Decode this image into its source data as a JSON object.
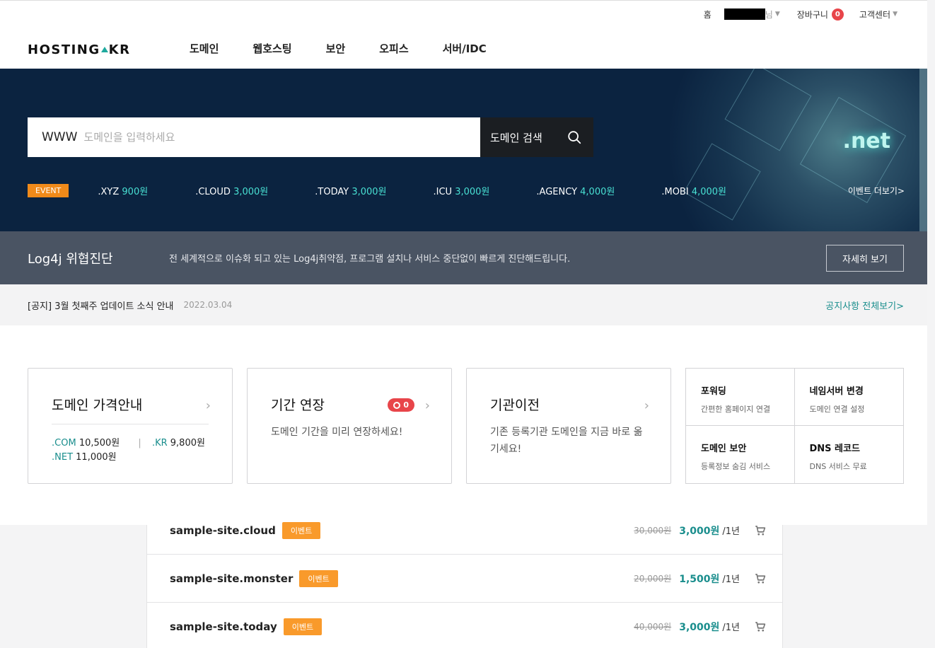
{
  "util": {
    "home": "홈",
    "user_suffix": "님",
    "cart_label": "장바구니",
    "cart_count": "0",
    "support": "고객센터"
  },
  "brand": {
    "logo_left": "HOSTING",
    "logo_right": "KR"
  },
  "gnb": [
    "도메인",
    "웹호스팅",
    "보안",
    "오피스",
    "서버/IDC"
  ],
  "hero": {
    "prefix": "WWW",
    "placeholder": "도메인을 입력하세요",
    "search_button": "도메인 검색",
    "tld_art": ".net",
    "event_tag": "EVENT",
    "events": [
      {
        "tld": ".XYZ",
        "price": "900원"
      },
      {
        "tld": ".CLOUD",
        "price": "3,000원"
      },
      {
        "tld": ".TODAY",
        "price": "3,000원"
      },
      {
        "tld": ".ICU",
        "price": "3,000원"
      },
      {
        "tld": ".AGENCY",
        "price": "4,000원"
      },
      {
        "tld": ".MOBI",
        "price": "4,000원"
      }
    ],
    "events_more": "이벤트 더보기>"
  },
  "log4j": {
    "title": "Log4j 위협진단",
    "desc": "전 세계적으로 이슈화 되고 있는 Log4j취약점, 프로그램 설치나 서비스 중단없이 빠르게 진단해드립니다.",
    "button": "자세히 보기"
  },
  "notice": {
    "text": "[공지] 3월 첫째주 업데이트 소식 안내",
    "date": "2022.03.04",
    "all": "공지사항 전체보기>"
  },
  "cards": {
    "price": {
      "title": "도메인 가격안내",
      "com_ext": ".COM",
      "com_price": "10,500원",
      "sep": "|",
      "kr_ext": ".KR",
      "kr_price": "9,800원",
      "net_ext": ".NET",
      "net_price": "11,000원"
    },
    "renew": {
      "title": "기간 연장",
      "count": "0",
      "desc": "도메인 기간을 미리 연장하세요!"
    },
    "transfer": {
      "title": "기관이전",
      "desc": "기존 등록기관 도메인을 지금 바로 옮기세요!"
    },
    "quick": [
      {
        "title": "포워딩",
        "sub": "간편한 홈페이지 연결"
      },
      {
        "title": "네임서버 변경",
        "sub": "도메인 연결 설정"
      },
      {
        "title": "도메인 보안",
        "sub": "등록정보 숨김 서비스"
      },
      {
        "title": "DNS 레코드",
        "sub": "DNS 서비스 무료"
      }
    ]
  },
  "list": [
    {
      "name": "sample-site.cloud",
      "tag": "이벤트",
      "old": "30,000원",
      "new": "3,000원",
      "unit": "/1년"
    },
    {
      "name": "sample-site.monster",
      "tag": "이벤트",
      "old": "20,000원",
      "new": "1,500원",
      "unit": "/1년"
    },
    {
      "name": "sample-site.today",
      "tag": "이벤트",
      "old": "40,000원",
      "new": "3,000원",
      "unit": "/1년"
    }
  ]
}
